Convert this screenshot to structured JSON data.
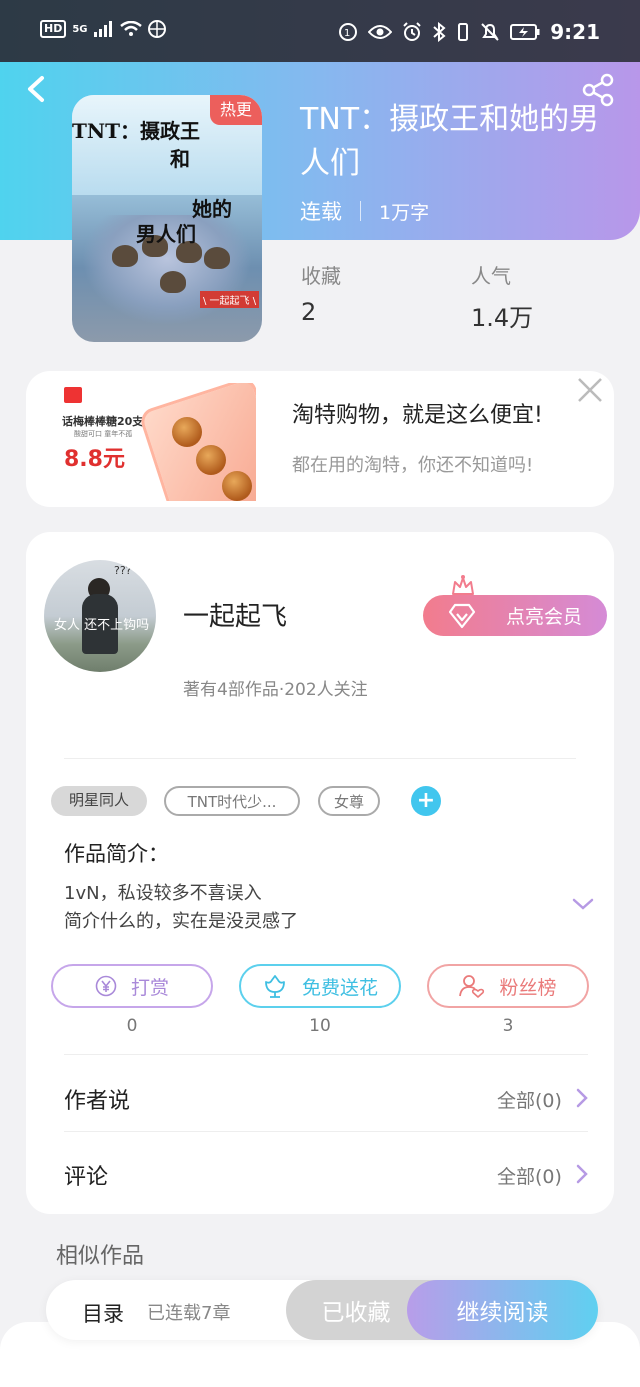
{
  "status_bar": {
    "network_hd": "HD",
    "network_5g": "5G",
    "time": "9:21"
  },
  "book": {
    "hot_badge": "热更",
    "title": "TNT：摄政王和她的男人们",
    "status": "连载",
    "word_count": "1万字",
    "favorites_label": "收藏",
    "favorites_value": "2",
    "popularity_label": "人气",
    "popularity_value": "1.4万",
    "cover_text": [
      "TNT：摄政王",
      "和",
      "她的",
      "男人们"
    ],
    "cover_stamp": "\\ 一起起飞 \\"
  },
  "ad": {
    "title": "淘特购物，就是这么便宜!",
    "description": "都在用的淘特，你还不知道吗!",
    "image_product": "话梅棒棒糖20支",
    "image_sub": "酸甜可口 童年不孤",
    "image_price": "8.8元"
  },
  "author": {
    "name": "一起起飞",
    "info": "著有4部作品·202人关注",
    "vip_button": "点亮会员",
    "avatar_text": "女人 还不上钩吗",
    "avatar_mark": "???"
  },
  "tags": [
    "明星同人",
    "TNT时代少...",
    "女尊"
  ],
  "tag_add": "+",
  "intro": {
    "title": "作品简介：",
    "line1": "1vN，私设较多不喜误入",
    "line2": "简介什么的，实在是没灵感了"
  },
  "actions": [
    {
      "label": "打赏",
      "count": "0"
    },
    {
      "label": "免费送花",
      "count": "10"
    },
    {
      "label": "粉丝榜",
      "count": "3"
    }
  ],
  "author_says": {
    "title": "作者说",
    "link": "全部(0)"
  },
  "comments": {
    "title": "评论",
    "link": "全部(0)"
  },
  "similar": {
    "title": "相似作品"
  },
  "bottom_bar": {
    "toc": "目录",
    "chapters": "已连载7章",
    "collected": "已收藏",
    "continue": "继续阅读"
  },
  "colors": {
    "header_start": "#4fd3ee",
    "header_end": "#b897ea",
    "accent_cyan": "#41c6ee",
    "accent_purple": "#b89de9",
    "hot_red": "#ec5f5c"
  },
  "icons": [
    "back-arrow-icon",
    "share-icon",
    "close-icon",
    "crown-icon",
    "diamond-icon",
    "yen-icon",
    "flower-icon",
    "fans-icon",
    "chevron-down-icon",
    "chevron-right-icon"
  ]
}
